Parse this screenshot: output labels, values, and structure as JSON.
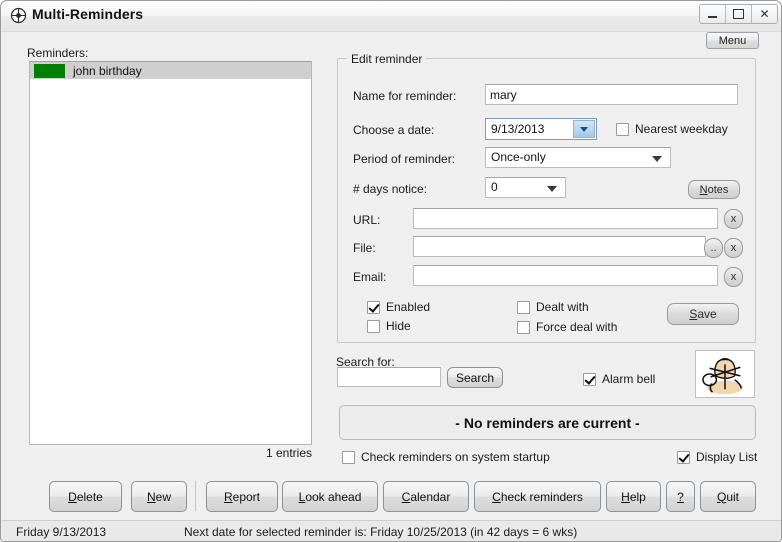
{
  "window": {
    "title": "Multi-Reminders",
    "icon": "compass-icon",
    "controls": {
      "minimize": "minimize-icon",
      "maximize": "maximize-icon",
      "close": "close-icon"
    }
  },
  "menu_button": {
    "label": "Menu"
  },
  "reminders_panel": {
    "label": "Reminders:",
    "items": [
      {
        "name": "john birthday",
        "color": "#008000",
        "selected": true
      }
    ],
    "entries_text": "1 entries"
  },
  "edit_group": {
    "title": "Edit reminder",
    "fields": {
      "name_label": "Name for reminder:",
      "name_value": "mary",
      "date_label": "Choose a date:",
      "date_value": "9/13/2013",
      "nearest_weekday_label": "Nearest weekday",
      "nearest_weekday_checked": false,
      "period_label": "Period of reminder:",
      "period_value": "Once-only",
      "days_notice_label": "# days notice:",
      "days_notice_value": "0",
      "notes_button": "Notes",
      "url_label": "URL:",
      "url_value": "",
      "file_label": "File:",
      "file_value": "",
      "email_label": "Email:",
      "email_value": "",
      "clear_button": "x",
      "browse_button": ".."
    },
    "checkboxes": [
      {
        "label": "Enabled",
        "checked": true
      },
      {
        "label": "Hide",
        "checked": false
      },
      {
        "label": "Dealt with",
        "checked": false
      },
      {
        "label": "Force deal with",
        "checked": false
      }
    ],
    "save_button": {
      "accel": "S",
      "rest": "ave"
    }
  },
  "search": {
    "label": "Search for:",
    "value": "",
    "button": "Search",
    "alarm_bell_label": "Alarm bell",
    "alarm_bell_checked": true,
    "bell_image": "alarm-bell-clipart"
  },
  "status_panel": {
    "text": "- No reminders are current -"
  },
  "options": {
    "startup_label": "Check reminders on system startup",
    "startup_checked": false,
    "display_list_label": "Display List",
    "display_list_checked": true
  },
  "toolbar_buttons": [
    {
      "accel": "D",
      "rest": "elete",
      "pre": ""
    },
    {
      "accel": "N",
      "rest": "ew",
      "pre": ""
    },
    {
      "accel": "R",
      "rest": "eport",
      "pre": ""
    },
    {
      "accel": "L",
      "rest": "ook ahead",
      "pre": ""
    },
    {
      "accel": "C",
      "rest": "alendar",
      "pre": ""
    },
    {
      "accel": "C",
      "rest": "heck reminders",
      "pre": ""
    },
    {
      "accel": "H",
      "rest": "elp",
      "pre": ""
    },
    {
      "accel": "?",
      "rest": "",
      "pre": ""
    },
    {
      "accel": "Q",
      "rest": "uit",
      "pre": ""
    }
  ],
  "statusbar": {
    "left": "Friday  9/13/2013",
    "middle": "Next date for selected reminder is: Friday 10/25/2013 (in 42 days = 6 wks)"
  }
}
